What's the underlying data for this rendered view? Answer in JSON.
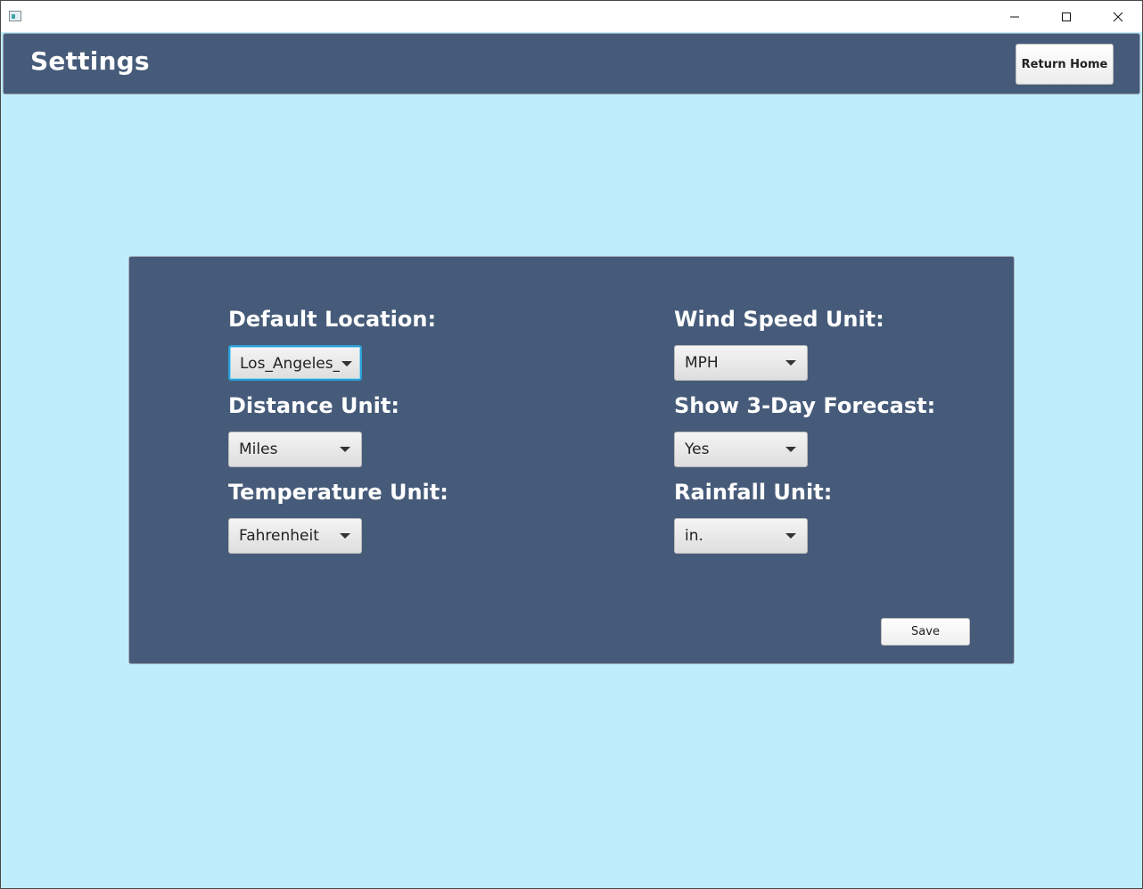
{
  "window": {
    "icons": {
      "app": "app-window-icon",
      "minimize": "minimize-icon",
      "maximize": "maximize-icon",
      "close": "close-icon"
    }
  },
  "header": {
    "title": "Settings",
    "return_home_label": "Return Home"
  },
  "settings": {
    "default_location": {
      "label": "Default Location:",
      "value": "Los_Angeles_..."
    },
    "wind_speed_unit": {
      "label": "Wind Speed Unit:",
      "value": "MPH"
    },
    "distance_unit": {
      "label": "Distance Unit:",
      "value": "Miles"
    },
    "show_forecast": {
      "label": "Show 3-Day Forecast:",
      "value": "Yes"
    },
    "temperature_unit": {
      "label": "Temperature Unit:",
      "value": "Fahrenheit"
    },
    "rainfall_unit": {
      "label": "Rainfall Unit:",
      "value": "in."
    },
    "save_label": "Save"
  },
  "colors": {
    "background": "#bfedfc",
    "panel": "#465b79",
    "header": "#465b79",
    "focus": "#2a9fd6"
  }
}
